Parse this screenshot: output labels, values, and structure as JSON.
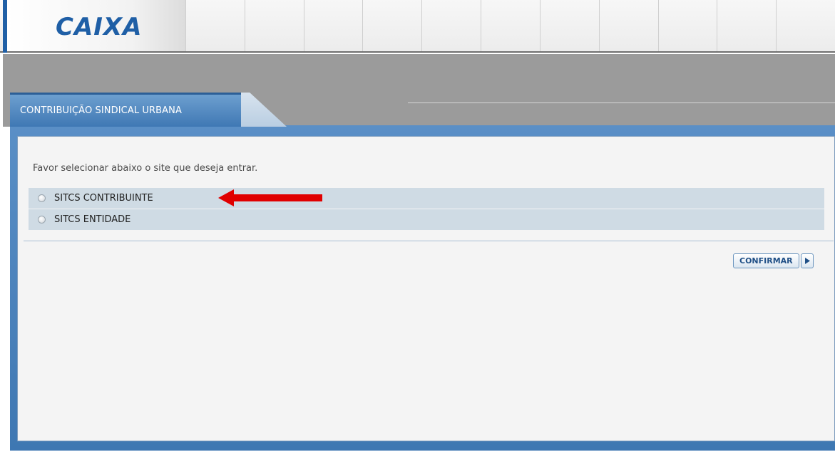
{
  "header": {
    "logo_text": "CAIXA",
    "brand_color": "#1f5fa6"
  },
  "tab": {
    "label": "CONTRIBUIÇÃO SINDICAL URBANA"
  },
  "main": {
    "instruction": "Favor selecionar abaixo o site que deseja entrar.",
    "options": [
      {
        "label": "SITCS CONTRIBUINTE",
        "selected": false
      },
      {
        "label": "SITCS ENTIDADE",
        "selected": false
      }
    ],
    "confirm_label": "CONFIRMAR",
    "annotation_arrow_color": "#e00000"
  },
  "icons": {
    "logo": "caixa-logo",
    "arrow": "red-arrow-left",
    "confirm": "play-triangle-icon"
  }
}
